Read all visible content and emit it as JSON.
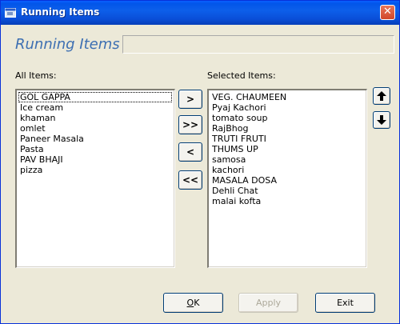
{
  "window": {
    "title": "Running Items"
  },
  "header": {
    "title": "Running Items"
  },
  "all_items": {
    "label": "All Items:",
    "items": [
      "GOL GAPPA",
      "Ice cream",
      "khaman",
      "omlet",
      "Paneer Masala",
      "Pasta",
      "PAV BHAJI",
      "pizza"
    ]
  },
  "selected_items": {
    "label": "Selected Items:",
    "items": [
      "VEG. CHAUMEEN",
      "Pyaj Kachori",
      "tomato soup",
      "RajBhog",
      "TRUTI FRUTI",
      "THUMS UP",
      "samosa",
      "kachori",
      "MASALA DOSA",
      "Dehli Chat",
      "malai kofta"
    ]
  },
  "move_buttons": {
    "add": ">",
    "add_all": ">>",
    "remove": "<",
    "remove_all": "<<"
  },
  "order_buttons": {
    "up_icon": "arrow-up-icon",
    "down_icon": "arrow-down-icon"
  },
  "footer": {
    "ok_label": "OK",
    "apply_label": "Apply",
    "exit_label": "Exit"
  }
}
